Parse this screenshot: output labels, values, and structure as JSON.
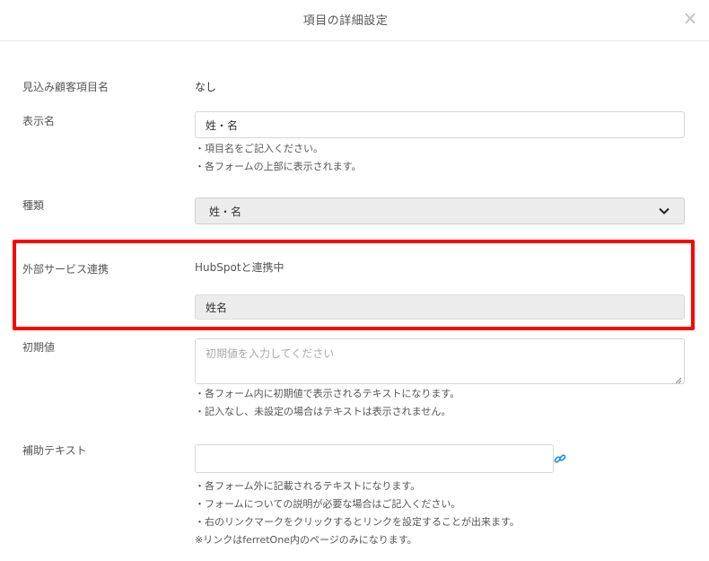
{
  "modal": {
    "title": "項目の詳細設定",
    "close": "×"
  },
  "fields": {
    "prospect_name": {
      "label": "見込み顧客項目名",
      "value": "なし"
    },
    "display_name": {
      "label": "表示名",
      "value": "姓・名",
      "hints": [
        "・項目名をご記入ください。",
        "・各フォームの上部に表示されます。"
      ]
    },
    "type": {
      "label": "種類",
      "selected": "姓・名"
    },
    "external_service": {
      "label": "外部サービス連携",
      "status": "HubSpotと連携中",
      "mapped_field": "姓名"
    },
    "initial_value": {
      "label": "初期値",
      "placeholder": "初期値を入力してください",
      "hints": [
        "・各フォーム内に初期値で表示されるテキストになります。",
        "・記入なし、未設定の場合はテキストは表示されません。"
      ]
    },
    "help_text": {
      "label": "補助テキスト",
      "value": "",
      "hints": [
        "・各フォーム外に記載されるテキストになります。",
        "・フォームについての説明が必要な場合はご記入ください。",
        "・右のリンクマークをクリックするとリンクを設定することが出来ます。",
        "※リンクはferretOne内のページのみになります。"
      ]
    }
  },
  "colors": {
    "highlight": "#ff0000",
    "link_icon": "#1a8fd8"
  }
}
